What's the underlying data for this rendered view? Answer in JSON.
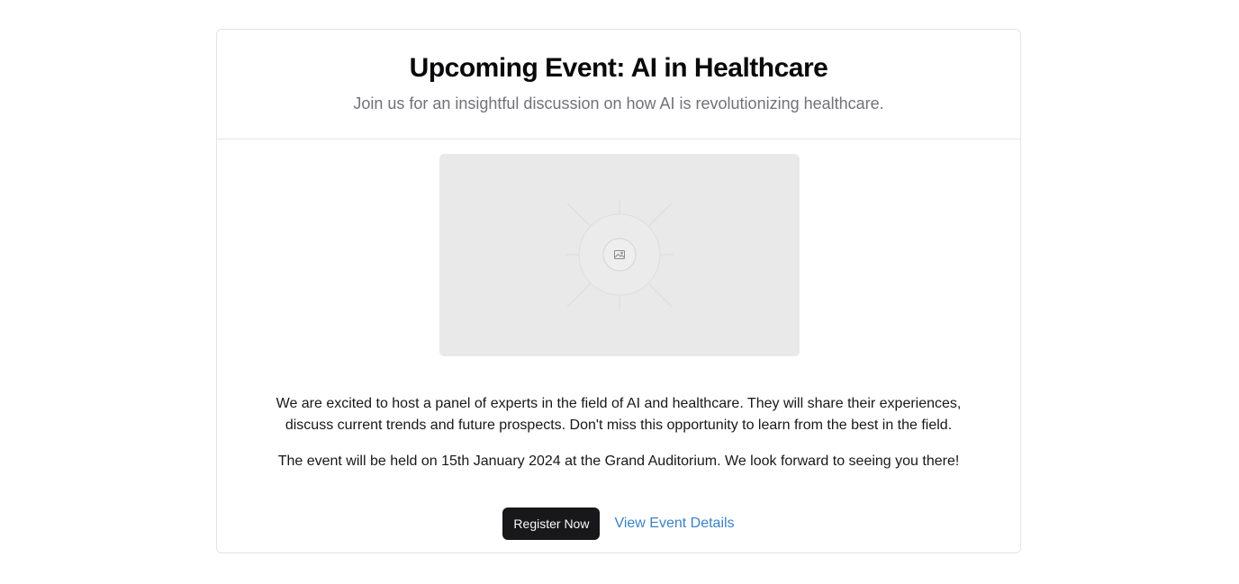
{
  "event": {
    "title": "Upcoming Event: AI in Healthcare",
    "subtitle": "Join us for an insightful discussion on how AI is revolutionizing healthcare."
  },
  "image": {
    "icon": "image-placeholder-icon",
    "background_color": "#e9e9e9"
  },
  "description": {
    "paragraph_1": "We are excited to host a panel of experts in the field of AI and healthcare. They will share their experiences, discuss current trends and future prospects. Don't miss this opportunity to learn from the best in the field.",
    "paragraph_2": "The event will be held on 15th January 2024 at the Grand Auditorium. We look forward to seeing you there!"
  },
  "actions": {
    "register_label": "Register Now",
    "details_label": "View Event Details"
  },
  "colors": {
    "primary_button": "#18181b",
    "link": "#3b82c4",
    "muted_text": "#71717a",
    "border": "#e4e4e7"
  }
}
